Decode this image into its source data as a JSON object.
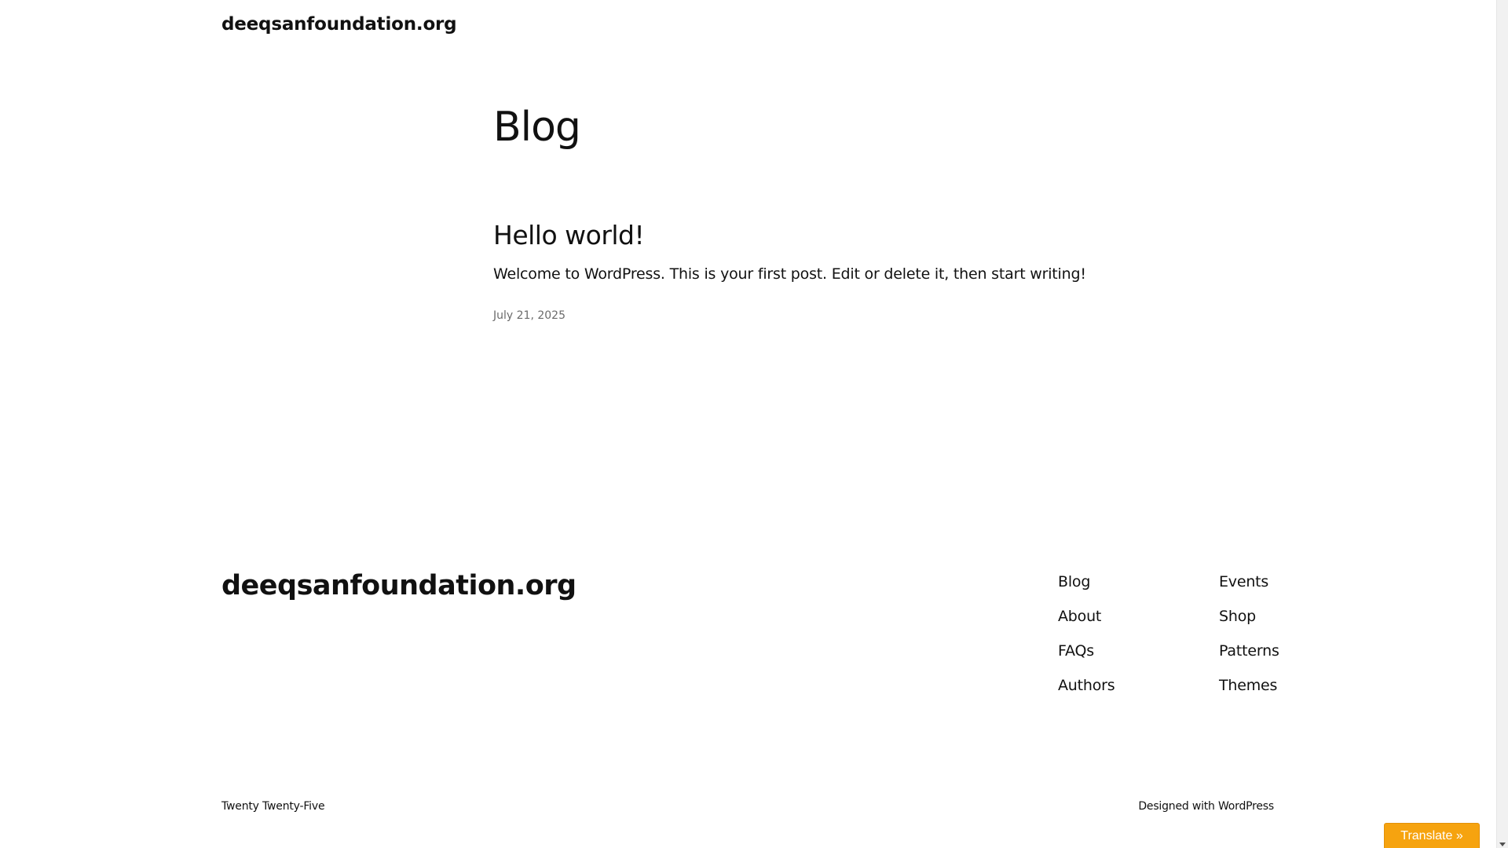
{
  "header": {
    "site_title": "deeqsanfoundation.org"
  },
  "main": {
    "heading": "Blog",
    "posts": [
      {
        "title": "Hello world!",
        "excerpt": "Welcome to WordPress. This is your first post. Edit or delete it, then start writing!",
        "date": "July 21, 2025"
      }
    ]
  },
  "footer": {
    "site_title": "deeqsanfoundation.org",
    "nav_col_1": [
      "Blog",
      "About",
      "FAQs",
      "Authors"
    ],
    "nav_col_2": [
      "Events",
      "Shop",
      "Patterns",
      "Themes"
    ],
    "credit": "Twenty Twenty-Five",
    "designed_with": "Designed with WordPress"
  },
  "widgets": {
    "translate_label": "Translate »"
  },
  "colors": {
    "text": "#111111",
    "date": "#6b6b6b",
    "translate_bg": "#f6a30f"
  }
}
